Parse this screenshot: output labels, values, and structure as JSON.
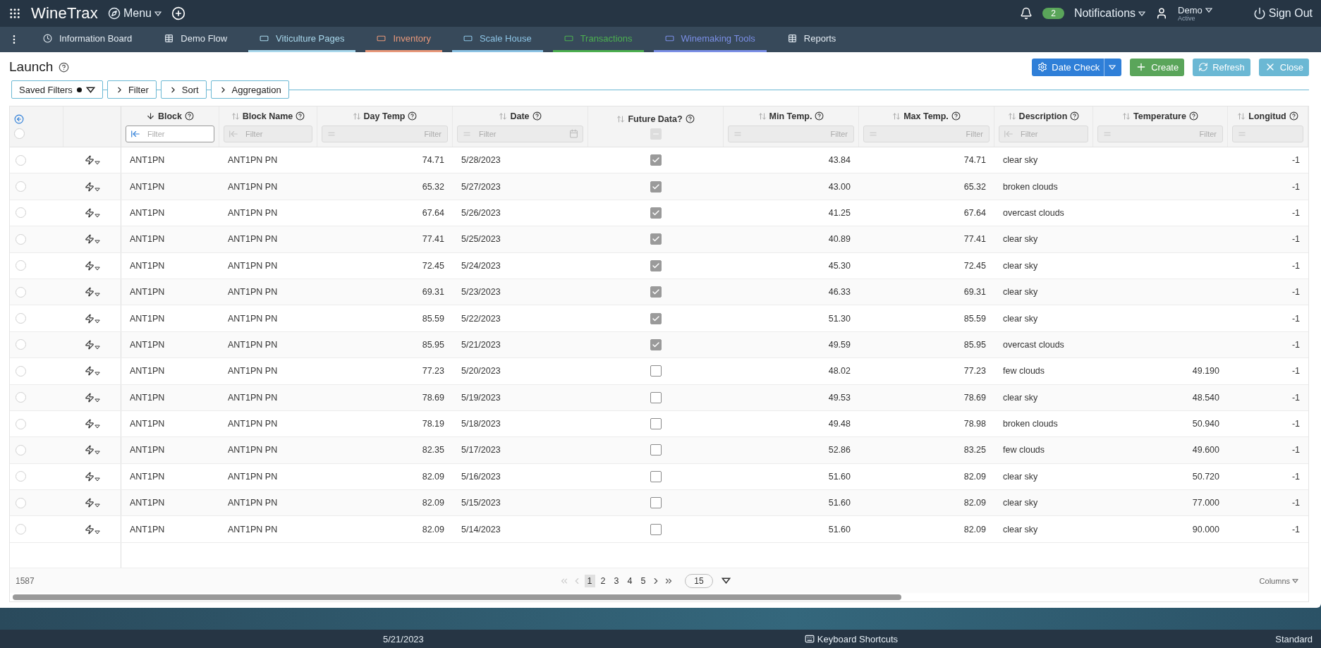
{
  "top_bar": {
    "logo": "WineTrax",
    "menu": "Menu",
    "notifications": {
      "count": "2",
      "label": "Notifications"
    },
    "user": {
      "name": "Demo",
      "status": "Active"
    },
    "sign_out": "Sign Out"
  },
  "nav_tabs": [
    {
      "label": "Information Board",
      "kind": "clock"
    },
    {
      "label": "Demo Flow",
      "kind": "grid"
    },
    {
      "label": "Viticulture Pages",
      "kind": "window",
      "color": "#a9d8ec"
    },
    {
      "label": "Inventory",
      "kind": "window",
      "color": "#e8987a"
    },
    {
      "label": "Scale House",
      "kind": "window",
      "color": "#8cc3e4"
    },
    {
      "label": "Transactions",
      "kind": "window",
      "color": "#4caf50"
    },
    {
      "label": "Winemaking Tools",
      "kind": "window",
      "color": "#7b8fe6"
    },
    {
      "label": "Reports",
      "kind": "grid"
    }
  ],
  "page": {
    "title": "Launch"
  },
  "actions": [
    {
      "label": "Date Check",
      "kind": "settings",
      "color": "#2f7fd8"
    },
    {
      "label": "Create",
      "kind": "create",
      "color": "#5aa55a"
    },
    {
      "label": "Refresh",
      "kind": "refresh",
      "color": "#6bb8d4"
    },
    {
      "label": "Close",
      "kind": "close",
      "color": "#6bb8d4"
    }
  ],
  "filter_chain": [
    {
      "label": "Saved Filters",
      "kind": "saved"
    },
    {
      "label": "Filter",
      "kind": "step"
    },
    {
      "label": "Sort",
      "kind": "step"
    },
    {
      "label": "Aggregation",
      "kind": "step"
    }
  ],
  "table": {
    "columns": [
      {
        "label": "Block",
        "kind": "text",
        "sorted": true,
        "placeholder": "Filter",
        "filter_enabled": true
      },
      {
        "label": "Block Name",
        "kind": "text",
        "sorted": false,
        "placeholder": "Filter",
        "filter_enabled": false
      },
      {
        "label": "Day Temp",
        "kind": "number",
        "sorted": false,
        "placeholder": "Filter",
        "filter_enabled": false
      },
      {
        "label": "Date",
        "kind": "date",
        "sorted": false,
        "placeholder": "Filter",
        "filter_enabled": false
      },
      {
        "label": "Future Data?",
        "kind": "check",
        "sorted": false,
        "filter_indeterminate": true
      },
      {
        "label": "Min Temp.",
        "kind": "number",
        "sorted": false,
        "placeholder": "Filter",
        "filter_enabled": false
      },
      {
        "label": "Max Temp.",
        "kind": "number",
        "sorted": false,
        "placeholder": "Filter",
        "filter_enabled": false
      },
      {
        "label": "Description",
        "kind": "text",
        "sorted": false,
        "placeholder": "Filter",
        "filter_enabled": false
      },
      {
        "label": "Temperature",
        "kind": "number",
        "sorted": false,
        "placeholder": "Filter",
        "filter_enabled": false
      },
      {
        "label": "Longitud",
        "kind": "number",
        "sorted": false,
        "filter_enabled": false
      }
    ],
    "rows": [
      {
        "selected": false,
        "cells": [
          "ANT1PN",
          "ANT1PN PN",
          "74.71",
          "5/28/2023",
          true,
          "43.84",
          "74.71",
          "clear sky",
          null,
          "-1"
        ]
      },
      {
        "selected": false,
        "cells": [
          "ANT1PN",
          "ANT1PN PN",
          "65.32",
          "5/27/2023",
          true,
          "43.00",
          "65.32",
          "broken clouds",
          null,
          "-1"
        ]
      },
      {
        "selected": false,
        "cells": [
          "ANT1PN",
          "ANT1PN PN",
          "67.64",
          "5/26/2023",
          true,
          "41.25",
          "67.64",
          "overcast clouds",
          null,
          "-1"
        ]
      },
      {
        "selected": false,
        "cells": [
          "ANT1PN",
          "ANT1PN PN",
          "77.41",
          "5/25/2023",
          true,
          "40.89",
          "77.41",
          "clear sky",
          null,
          "-1"
        ]
      },
      {
        "selected": false,
        "cells": [
          "ANT1PN",
          "ANT1PN PN",
          "72.45",
          "5/24/2023",
          true,
          "45.30",
          "72.45",
          "clear sky",
          null,
          "-1"
        ]
      },
      {
        "selected": false,
        "cells": [
          "ANT1PN",
          "ANT1PN PN",
          "69.31",
          "5/23/2023",
          true,
          "46.33",
          "69.31",
          "clear sky",
          null,
          "-1"
        ]
      },
      {
        "selected": false,
        "cells": [
          "ANT1PN",
          "ANT1PN PN",
          "85.59",
          "5/22/2023",
          true,
          "51.30",
          "85.59",
          "clear sky",
          null,
          "-1"
        ]
      },
      {
        "selected": false,
        "cells": [
          "ANT1PN",
          "ANT1PN PN",
          "85.95",
          "5/21/2023",
          true,
          "49.59",
          "85.95",
          "overcast clouds",
          null,
          "-1"
        ]
      },
      {
        "selected": false,
        "cells": [
          "ANT1PN",
          "ANT1PN PN",
          "77.23",
          "5/20/2023",
          false,
          "48.02",
          "77.23",
          "few clouds",
          "49.190",
          "-1"
        ]
      },
      {
        "selected": false,
        "cells": [
          "ANT1PN",
          "ANT1PN PN",
          "78.69",
          "5/19/2023",
          false,
          "49.53",
          "78.69",
          "clear sky",
          "48.540",
          "-1"
        ]
      },
      {
        "selected": false,
        "cells": [
          "ANT1PN",
          "ANT1PN PN",
          "78.19",
          "5/18/2023",
          false,
          "49.48",
          "78.98",
          "broken clouds",
          "50.940",
          "-1"
        ]
      },
      {
        "selected": false,
        "cells": [
          "ANT1PN",
          "ANT1PN PN",
          "82.35",
          "5/17/2023",
          false,
          "52.86",
          "83.25",
          "few clouds",
          "49.600",
          "-1"
        ]
      },
      {
        "selected": false,
        "cells": [
          "ANT1PN",
          "ANT1PN PN",
          "82.09",
          "5/16/2023",
          false,
          "51.60",
          "82.09",
          "clear sky",
          "50.720",
          "-1"
        ]
      },
      {
        "selected": false,
        "cells": [
          "ANT1PN",
          "ANT1PN PN",
          "82.09",
          "5/15/2023",
          false,
          "51.60",
          "82.09",
          "clear sky",
          "77.000",
          "-1"
        ]
      },
      {
        "selected": false,
        "cells": [
          "ANT1PN",
          "ANT1PN PN",
          "82.09",
          "5/14/2023",
          false,
          "51.60",
          "82.09",
          "clear sky",
          "90.000",
          "-1"
        ]
      }
    ],
    "all_selected": false,
    "total": "1587",
    "pagination": {
      "pages": [
        {
          "label": "1",
          "selected": true
        },
        {
          "label": "2",
          "selected": false
        },
        {
          "label": "3",
          "selected": false
        },
        {
          "label": "4",
          "selected": false
        },
        {
          "label": "5",
          "selected": false
        }
      ],
      "page_size": "15"
    },
    "columns_button": "Columns"
  },
  "status_bar": {
    "date": "5/21/2023",
    "shortcuts": "Keyboard Shortcuts",
    "mode": "Standard"
  }
}
